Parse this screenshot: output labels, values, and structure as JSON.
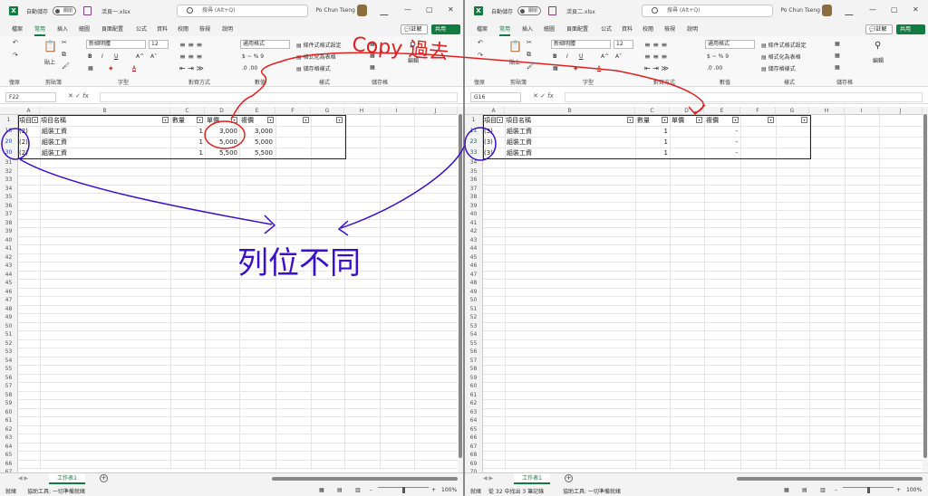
{
  "colors": {
    "accent": "#107c41",
    "annotation_red": "#e02020",
    "annotation_blue": "#3a10c8"
  },
  "left": {
    "autosave": "自動儲存",
    "toggle": "關閉",
    "filename": "活頁一.xlsx",
    "search": "搜尋 (Alt+Q)",
    "user": "Po Chun Tseng",
    "namebox": "F22",
    "tabs": [
      "檔案",
      "常用",
      "插入",
      "繪圖",
      "頁面配置",
      "公式",
      "資料",
      "校閱",
      "檢視",
      "說明"
    ],
    "comment": "註解",
    "share": "共用",
    "ribbon": {
      "undo": "復原",
      "clip": "剪貼簿",
      "paste": "貼上",
      "font_name": "新細明體",
      "font_size": "12",
      "font_grp": "字型",
      "align": "對齊方式",
      "numfmt": "通用格式",
      "number": "數值",
      "cond": "條件式格式設定",
      "asTable": "格式化為表格",
      "cellStyle": "儲存格樣式",
      "styles": "樣式",
      "cells_btn": "儲存格",
      "edit": "編輯"
    },
    "cols": [
      "A",
      "B",
      "C",
      "D",
      "E",
      "F",
      "G",
      "H",
      "I",
      "J"
    ],
    "headers": [
      "項目",
      "項目名稱",
      "數量",
      "單價",
      "複價",
      "",
      ""
    ],
    "rownums": [
      "1",
      "10",
      "20",
      "30",
      "31",
      "32",
      "33",
      "34",
      "35",
      "36",
      "37",
      "38",
      "39",
      "40",
      "41",
      "42",
      "43",
      "44",
      "45",
      "46",
      "47",
      "48",
      "49",
      "50",
      "51",
      "52",
      "53",
      "54",
      "55",
      "56",
      "57",
      "58",
      "59",
      "60",
      "61",
      "62",
      "63",
      "64",
      "65",
      "66",
      "67",
      "68"
    ],
    "rows": [
      {
        "a": "(2)",
        "b": "組裝工資",
        "c": "1",
        "d": "3,000",
        "e": "3,000"
      },
      {
        "a": "(2)",
        "b": "組裝工資",
        "c": "1",
        "d": "5,000",
        "e": "5,000"
      },
      {
        "a": "(2)",
        "b": "組裝工資",
        "c": "1",
        "d": "5,500",
        "e": "5,500"
      }
    ],
    "sheet_tab": "工作表1",
    "status": [
      "就緒",
      "協助工具: 一切準備就緒"
    ],
    "zoom": "100%"
  },
  "right": {
    "autosave": "自動儲存",
    "toggle": "關閉",
    "filename": "活頁二.xlsx",
    "search": "搜尋 (Alt+Q)",
    "user": "Po Chun Tseng",
    "namebox": "G16",
    "tabs": [
      "檔案",
      "常用",
      "插入",
      "繪圖",
      "頁面配置",
      "公式",
      "資料",
      "校閱",
      "檢視",
      "說明"
    ],
    "comment": "註解",
    "share": "共用",
    "ribbon": {
      "undo": "復原",
      "clip": "剪貼簿",
      "paste": "貼上",
      "font_name": "新細明體",
      "font_size": "12",
      "font_grp": "字型",
      "align": "對齊方式",
      "numfmt": "通用格式",
      "number": "數值",
      "cond": "條件式格式設定",
      "asTable": "格式化為表格",
      "cellStyle": "儲存格樣式",
      "styles": "樣式",
      "cells_btn": "儲存格",
      "insert": "插入",
      "del": "刪除",
      "fmt": "格式",
      "edit": "編輯"
    },
    "cols": [
      "A",
      "B",
      "C",
      "D",
      "E",
      "F",
      "G",
      "H",
      "I",
      "J"
    ],
    "headers": [
      "項目",
      "項目名稱",
      "數量",
      "單價",
      "複價",
      "",
      ""
    ],
    "rownums": [
      "1",
      "11",
      "23",
      "33",
      "34",
      "35",
      "36",
      "37",
      "38",
      "39",
      "40",
      "41",
      "42",
      "43",
      "44",
      "45",
      "46",
      "47",
      "48",
      "49",
      "50",
      "51",
      "52",
      "53",
      "54",
      "55",
      "56",
      "57",
      "58",
      "59",
      "60",
      "61",
      "62",
      "63",
      "64",
      "65",
      "66",
      "67",
      "68",
      "69",
      "70",
      "71"
    ],
    "rows": [
      {
        "a": "(3)",
        "b": "組裝工資",
        "c": "1",
        "d": "",
        "e": "-"
      },
      {
        "a": "(3)",
        "b": "組裝工資",
        "c": "1",
        "d": "",
        "e": "-"
      },
      {
        "a": "(3)",
        "b": "組裝工資",
        "c": "1",
        "d": "",
        "e": "-"
      }
    ],
    "sheet_tab": "工作表1",
    "status": [
      "就緒",
      "從 32 中找出 3 筆記錄",
      "協助工具: 一切準備就緒"
    ],
    "zoom": "100%"
  },
  "annotations": {
    "copy_text": "Copy 過去",
    "row_diff_text": "列位不同"
  }
}
